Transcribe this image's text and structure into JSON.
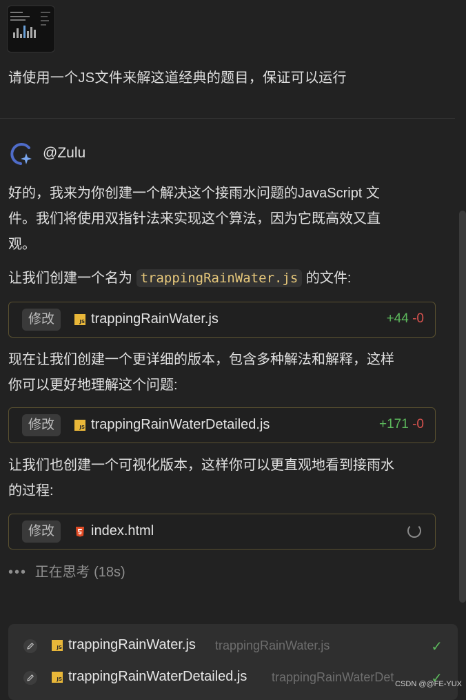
{
  "user_message": "请使用一个JS文件来解这道经典的题目，保证可以运行",
  "agent": {
    "name": "@Zulu"
  },
  "messages": [
    {
      "line1": "好的，我来为你创建一个解决这个接雨水问题的JavaScript 文",
      "line2": "件。我们将使用双指针法来实现这个算法，因为它既高效又直",
      "line3": "观。"
    },
    {
      "before": "让我们创建一个名为",
      "code": "trappingRainWater.js",
      "after": "的文件:"
    },
    {
      "line1": "现在让我们创建一个更详细的版本，包含多种解法和解释，这样",
      "line2": "你可以更好地理解这个问题:"
    },
    {
      "line1": "让我们也创建一个可视化版本，这样你可以更直观地看到接雨水",
      "line2": "的过程:"
    }
  ],
  "file_cards": [
    {
      "tag": "修改",
      "name": "trappingRainWater.js",
      "added": "+44",
      "removed": "-0",
      "icon": "js-icon"
    },
    {
      "tag": "修改",
      "name": "trappingRainWaterDetailed.js",
      "added": "+171",
      "removed": "-0",
      "icon": "js-icon"
    },
    {
      "tag": "修改",
      "name": "index.html",
      "icon": "html5-icon",
      "status": "loading"
    }
  ],
  "thinking": {
    "dots": "•••",
    "label": "正在思考 (18s)"
  },
  "changed_files": [
    {
      "name": "trappingRainWater.js",
      "path": "trappingRainWater.js",
      "icon": "js-icon"
    },
    {
      "name": "trappingRainWaterDetailed.js",
      "path": "trappingRainWaterDet",
      "icon": "js-icon"
    }
  ],
  "watermark": "CSDN @@FE-YUX",
  "colors": {
    "accent_add": "#5cb85c",
    "accent_remove": "#d9534f",
    "code_text": "#e7c87b",
    "card_border": "#5a5130"
  }
}
